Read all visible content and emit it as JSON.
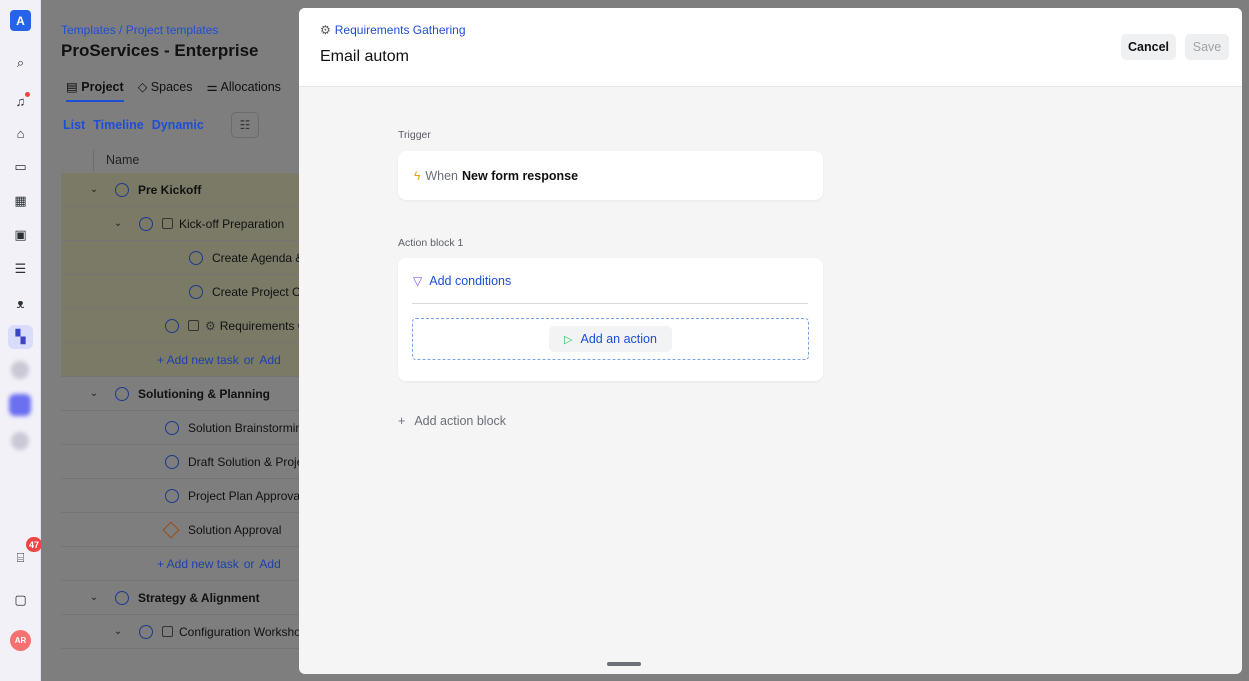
{
  "rail": {
    "logo": "A",
    "icons": [
      "search-icon",
      "bell-icon",
      "home-icon",
      "dashboard-icon",
      "building-icon",
      "clipboard-icon",
      "checklist-icon",
      "people-icon",
      "grid-icon"
    ],
    "gift_badge": "47",
    "avatar": "AR"
  },
  "app": {
    "breadcrumb": "Templates / Project templates",
    "title": "ProServices - Enterprise",
    "tabs": [
      "Project",
      "Spaces",
      "Allocations"
    ],
    "views": [
      "List",
      "Timeline",
      "Dynamic"
    ],
    "column_name": "Name",
    "rows": [
      {
        "text": "Pre Kickoff"
      },
      {
        "text": "Kick-off Preparation"
      },
      {
        "text": "Create Agenda & Slides"
      },
      {
        "text": "Create Project Charter"
      },
      {
        "text": "Requirements Gathering"
      },
      {
        "add": "+  Add new task",
        "or": "or",
        "add2": "Add"
      },
      {
        "text": "Solutioning & Planning"
      },
      {
        "text": "Solution Brainstorming"
      },
      {
        "text": "Draft Solution & Project Plan"
      },
      {
        "text": "Project Plan Approval"
      },
      {
        "text": "Solution Approval"
      },
      {
        "add": "+  Add new task",
        "or": "or",
        "add2": "Add"
      },
      {
        "text": "Strategy & Alignment"
      },
      {
        "text": "Configuration Workshop"
      }
    ]
  },
  "panel": {
    "breadcrumb": "Requirements Gathering",
    "title": "Email autom",
    "cancel": "Cancel",
    "save": "Save",
    "trigger_label": "Trigger",
    "trigger_when": "When",
    "trigger_event": "New form response",
    "action_block_label": "Action block 1",
    "add_conditions": "Add conditions",
    "add_action": "Add an action",
    "add_action_block": "Add action block"
  },
  "colors": {
    "accent": "#1d4ed8",
    "badge": "#ef4444",
    "trigger_icon": "#f59e0b",
    "action_icon": "#22c55e"
  }
}
